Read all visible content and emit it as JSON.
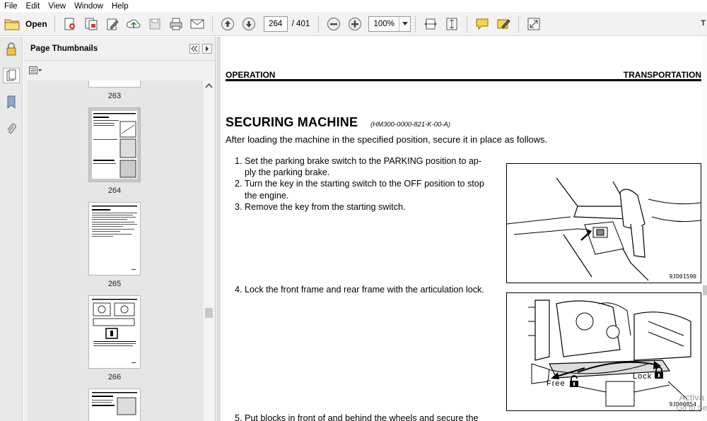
{
  "menu": {
    "items": [
      "File",
      "Edit",
      "View",
      "Window",
      "Help"
    ]
  },
  "toolbar": {
    "open_label": "Open",
    "page_current": "264",
    "page_total": "/ 401",
    "zoom": "100%",
    "tail_text": "T"
  },
  "thumbnails": {
    "title": "Page Thumbnails",
    "pages": [
      "263",
      "264",
      "265",
      "266"
    ],
    "selected": "264"
  },
  "document": {
    "header_left": "OPERATION",
    "header_right": "TRANSPORTATION",
    "section_title": "SECURING MACHINE",
    "section_code": "(HM300-0000-821-K-00-A)",
    "intro": "After loading the machine in the specified position, secure it in place as follows.",
    "steps": [
      {
        "n": "1.",
        "lines": [
          "Set the parking brake switch to the PARKING position to ap-",
          "ply the parking brake."
        ]
      },
      {
        "n": "2.",
        "lines": [
          "Turn the key in the starting switch to the OFF position to stop",
          "the engine."
        ]
      },
      {
        "n": "3.",
        "lines": [
          "Remove the key from the starting switch."
        ]
      },
      {
        "n": "4.",
        "lines": [
          "Lock the front frame and rear frame with the articulation lock."
        ]
      },
      {
        "n": "5.",
        "lines": [
          "Put blocks in front of and behind the wheels and secure the"
        ]
      }
    ],
    "figure1_code": "9JD01590",
    "figure2_code": "9JD00854",
    "figure2_free": "Free",
    "figure2_lock": "Lock"
  },
  "os_watermark": {
    "line1": "Activa",
    "line2": "Go to Se"
  },
  "colors": {
    "toolbar_bg": "#f2f2f2",
    "panel_bg": "#f0f0f0",
    "accent_yellow": "#f5c518"
  }
}
